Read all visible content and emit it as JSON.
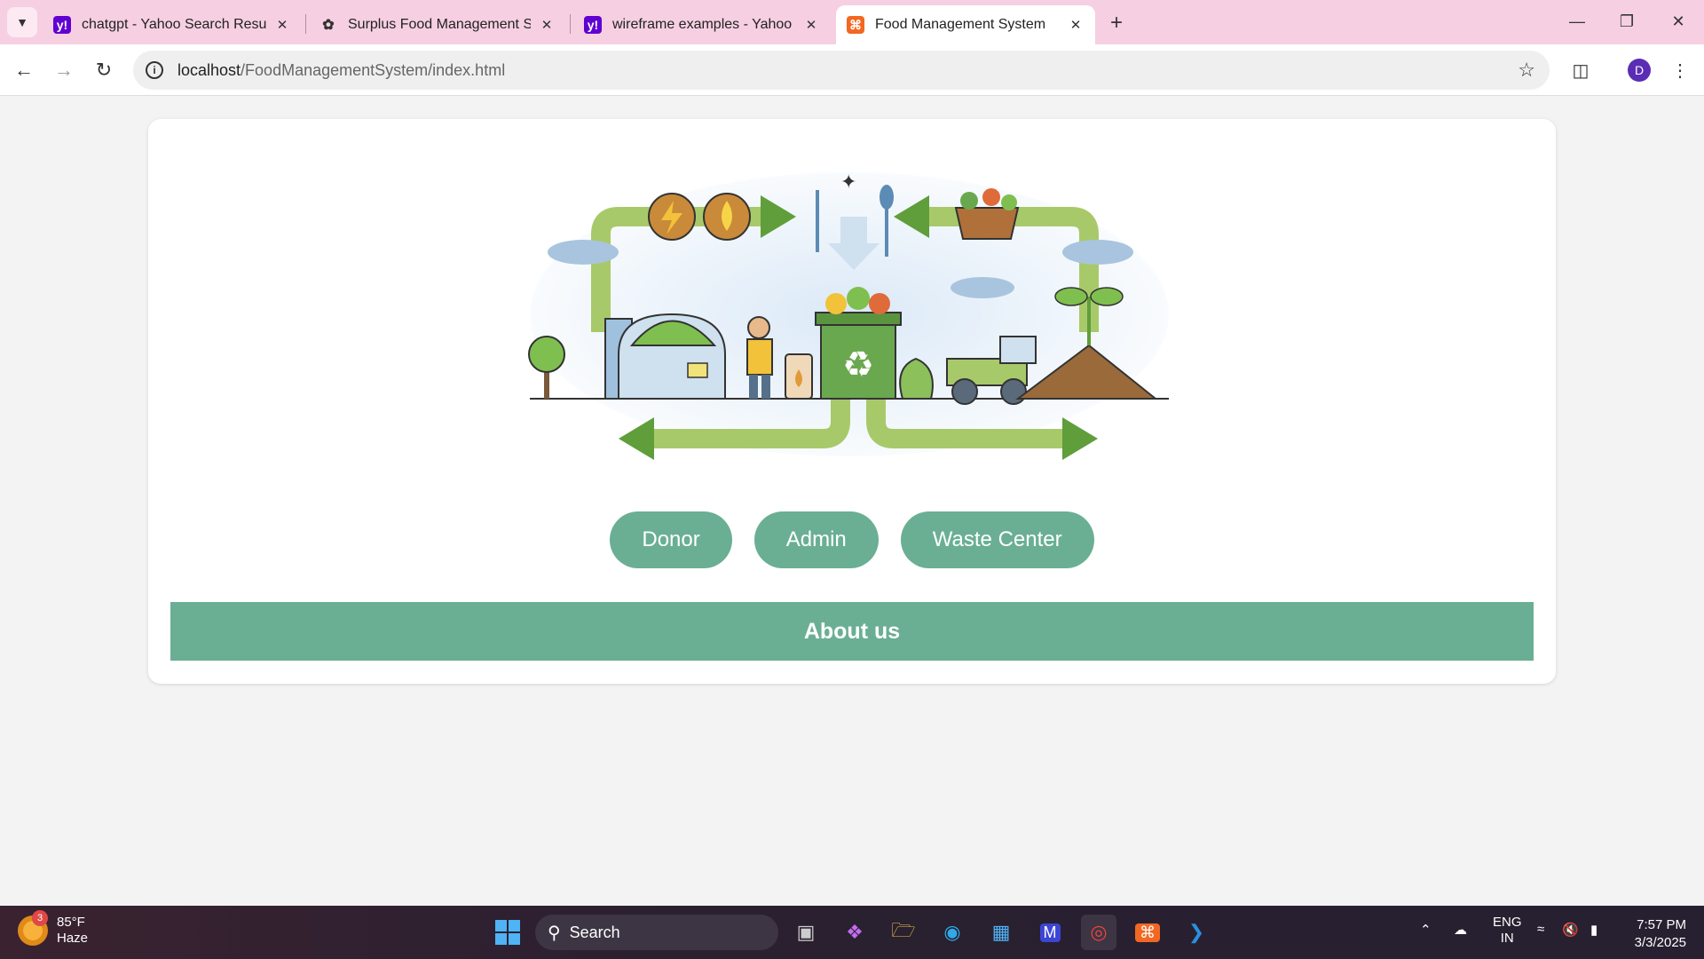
{
  "browser": {
    "tabs": [
      {
        "title": "chatgpt - Yahoo Search Results",
        "favicon": "yahoo-icon",
        "active": false
      },
      {
        "title": "Surplus Food Management Syst",
        "favicon": "chatgpt-icon",
        "active": false
      },
      {
        "title": "wireframe examples - Yahoo Im",
        "favicon": "yahoo-icon",
        "active": false
      },
      {
        "title": "Food Management System",
        "favicon": "xampp-icon",
        "active": true
      }
    ],
    "url_host": "localhost",
    "url_path": "/FoodManagementSystem/index.html",
    "profile_initial": "D"
  },
  "page": {
    "buttons": [
      "Donor",
      "Admin",
      "Waste Center"
    ],
    "about_label": "About us",
    "accent_color": "#6aaf93"
  },
  "taskbar": {
    "weather_temp": "85°F",
    "weather_desc": "Haze",
    "weather_badge": "3",
    "search_label": "Search",
    "lang_top": "ENG",
    "lang_bottom": "IN",
    "time": "7:57 PM",
    "date": "3/3/2025"
  }
}
